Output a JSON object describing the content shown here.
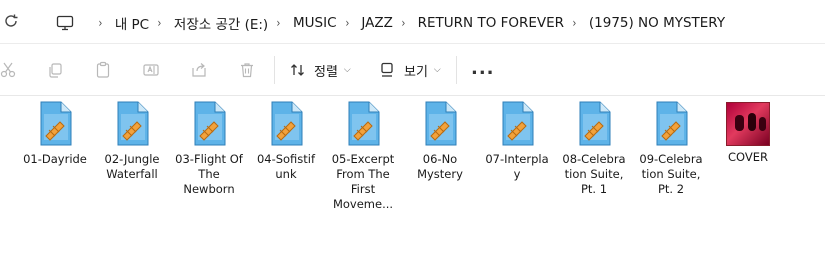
{
  "breadcrumb": {
    "segments": [
      "내 PC",
      "저장소 공간 (E:)",
      "MUSIC",
      "JAZZ",
      "RETURN TO FOREVER",
      "(1975) NO MYSTERY"
    ],
    "separator": "›"
  },
  "toolbar": {
    "sort_label": "정렬",
    "view_label": "보기",
    "more_label": "..."
  },
  "files": [
    {
      "name": "01-Dayride"
    },
    {
      "name": "02-Jungle Waterfall"
    },
    {
      "name": "03-Flight Of The Newborn"
    },
    {
      "name": "04-Sofistif unk"
    },
    {
      "name": "05-Excerpt From The First Moveme..."
    },
    {
      "name": "06-No Mystery"
    },
    {
      "name": "07-Interpla y"
    },
    {
      "name": "08-Celebra tion Suite, Pt. 1"
    },
    {
      "name": "09-Celebra tion Suite, Pt. 2"
    },
    {
      "name": "COVER"
    }
  ],
  "colors": {
    "audio_icon_blue": "#4aa3df",
    "audio_icon_orange": "#f2a23c",
    "cover_red": "#c8103e"
  }
}
